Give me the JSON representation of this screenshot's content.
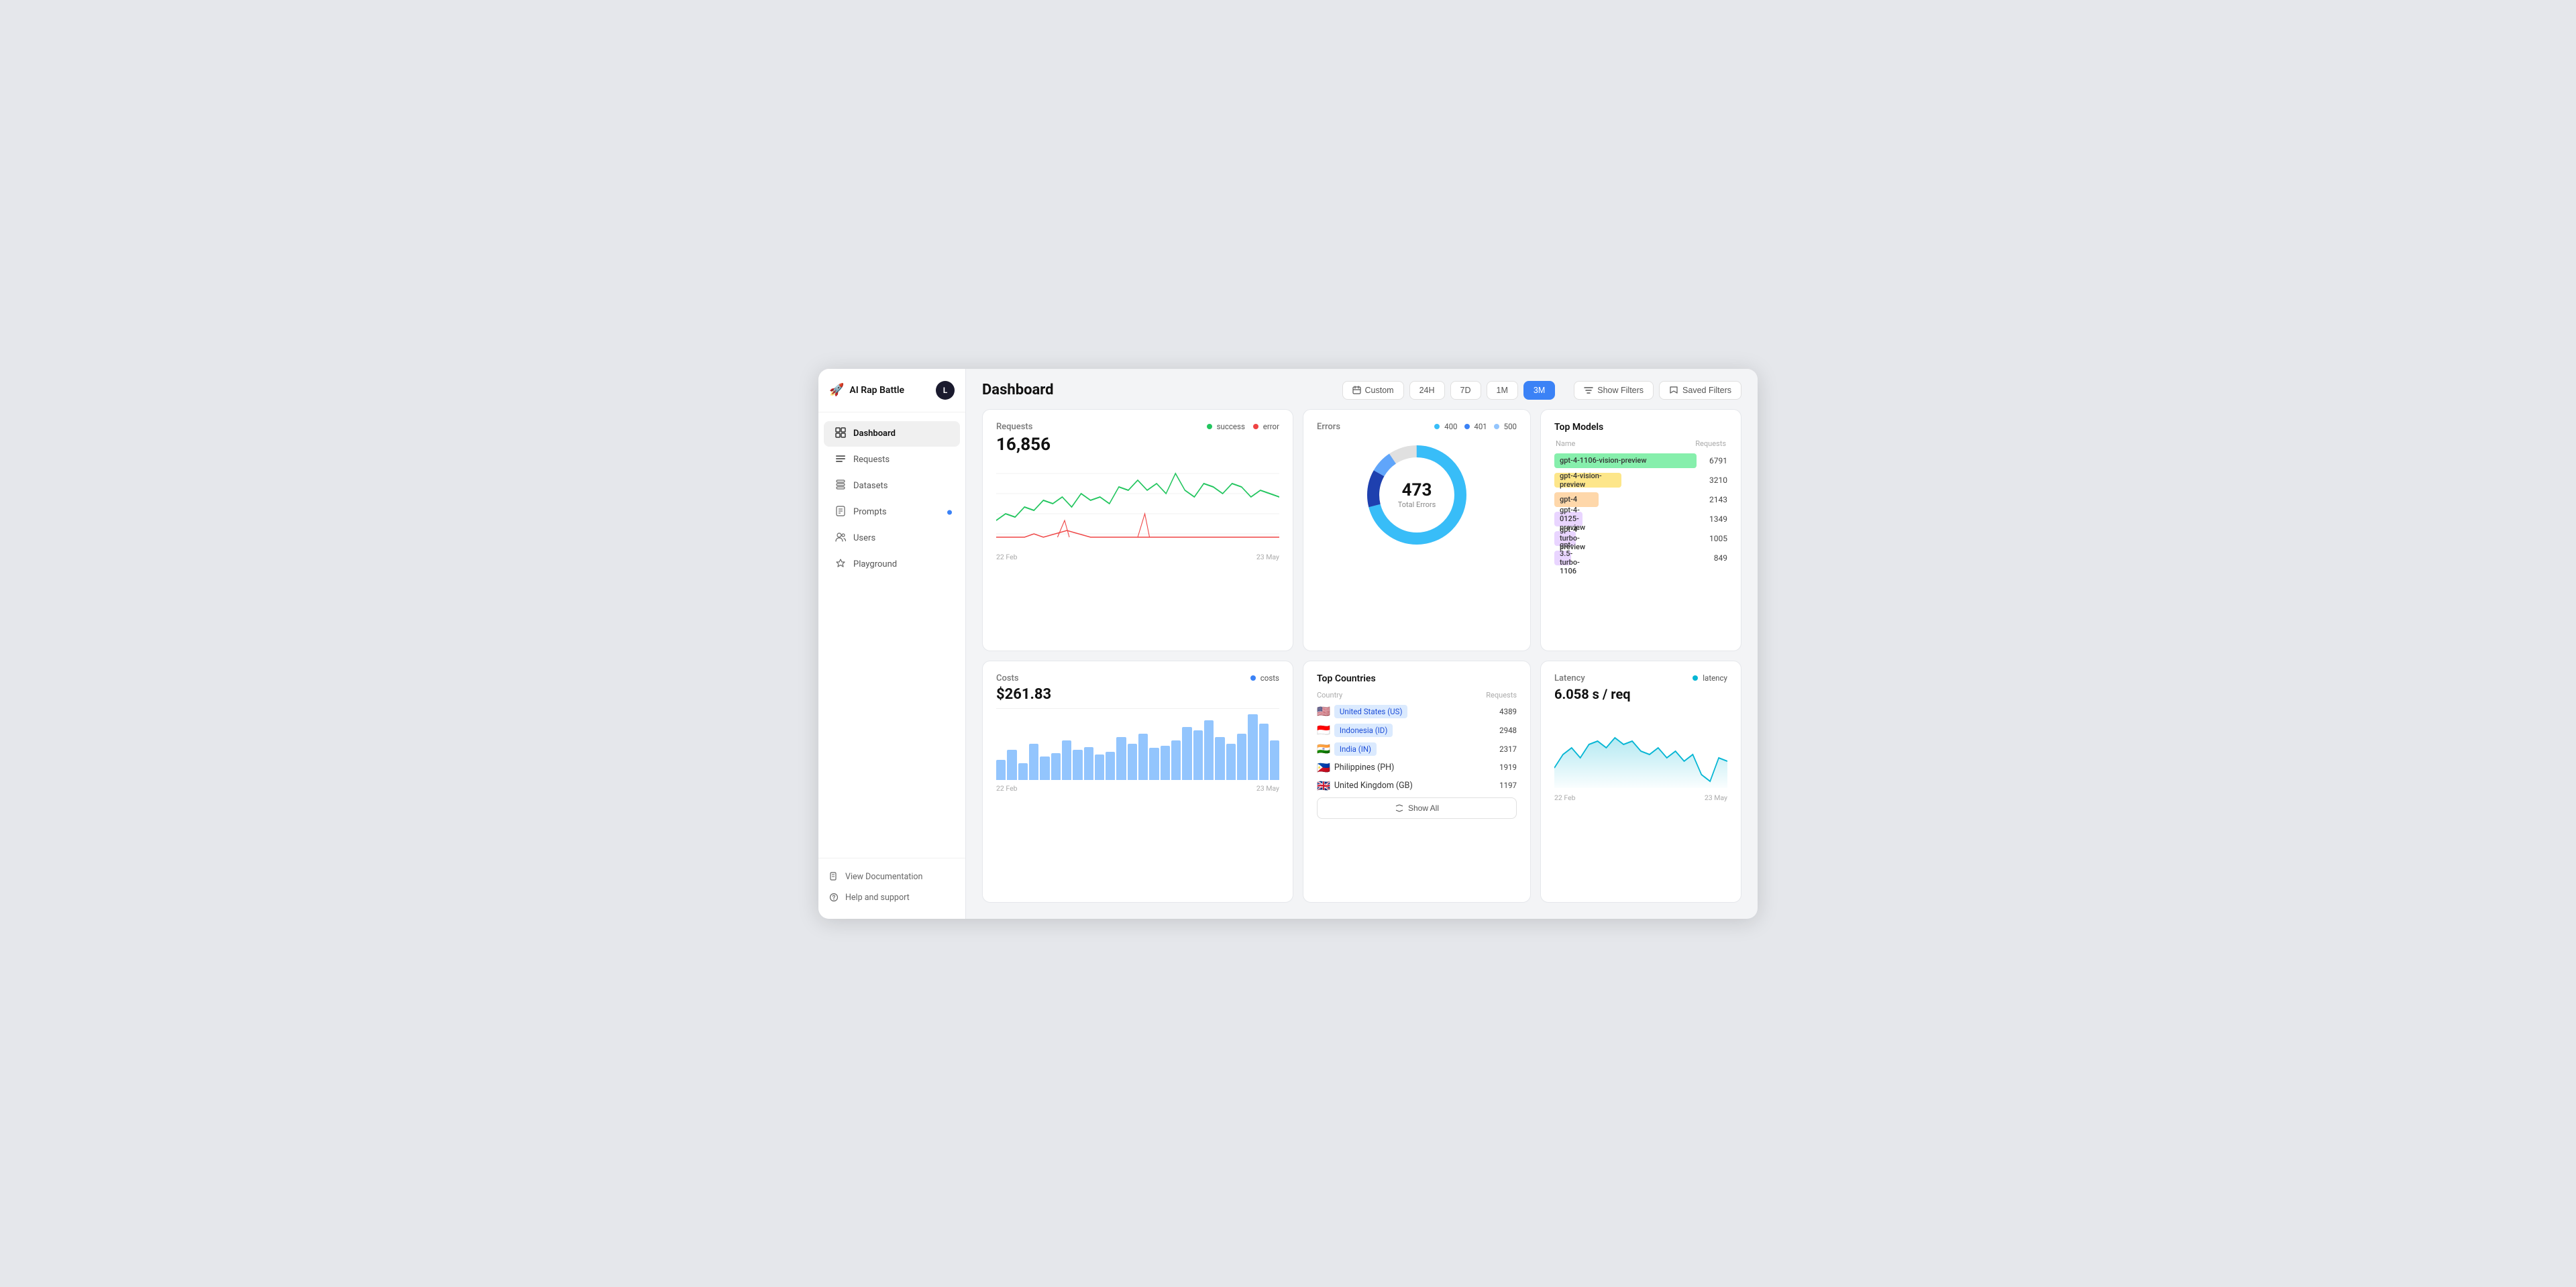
{
  "app": {
    "name": "AI Rap Battle",
    "avatar_letter": "L"
  },
  "sidebar": {
    "nav_items": [
      {
        "id": "dashboard",
        "label": "Dashboard",
        "icon": "⊞",
        "active": true
      },
      {
        "id": "requests",
        "label": "Requests",
        "icon": "☰",
        "active": false
      },
      {
        "id": "datasets",
        "label": "Datasets",
        "icon": "🗂",
        "active": false
      },
      {
        "id": "prompts",
        "label": "Prompts",
        "icon": "📄",
        "active": false,
        "dot": true
      },
      {
        "id": "users",
        "label": "Users",
        "icon": "👥",
        "active": false
      },
      {
        "id": "playground",
        "label": "Playground",
        "icon": "🔬",
        "active": false
      }
    ],
    "footer_items": [
      {
        "id": "docs",
        "label": "View Documentation",
        "icon": "📖"
      },
      {
        "id": "support",
        "label": "Help and support",
        "icon": "❓"
      }
    ]
  },
  "header": {
    "title": "Dashboard",
    "time_buttons": [
      {
        "label": "Custom",
        "id": "custom",
        "active": false,
        "icon": "📅"
      },
      {
        "label": "24H",
        "id": "24h",
        "active": false
      },
      {
        "label": "7D",
        "id": "7d",
        "active": false
      },
      {
        "label": "1M",
        "id": "1m",
        "active": false
      },
      {
        "label": "3M",
        "id": "3m",
        "active": true
      }
    ],
    "action_buttons": [
      {
        "label": "Show Filters",
        "id": "show-filters",
        "icon": "filter"
      },
      {
        "label": "Saved Filters",
        "id": "saved-filters",
        "icon": "bookmark"
      }
    ]
  },
  "cards": {
    "requests": {
      "title": "Requests",
      "value": "16,856",
      "legend": [
        {
          "label": "success",
          "color": "#22c55e"
        },
        {
          "label": "error",
          "color": "#ef4444"
        }
      ],
      "date_start": "22 Feb",
      "date_end": "23 May"
    },
    "errors": {
      "title": "Errors",
      "legend": [
        {
          "label": "400",
          "color": "#38bdf8"
        },
        {
          "label": "401",
          "color": "#3b82f6"
        },
        {
          "label": "500",
          "color": "#93c5fd"
        }
      ],
      "total": "473",
      "total_label": "Total Errors"
    },
    "top_models": {
      "title": "Top Models",
      "col_name": "Name",
      "col_requests": "Requests",
      "models": [
        {
          "name": "gpt-4-1106-vision-preview",
          "count": 6791,
          "color": "#86efac",
          "width": 100
        },
        {
          "name": "gpt-4-vision-preview",
          "count": 3210,
          "color": "#fde68a",
          "width": 47
        },
        {
          "name": "gpt-4",
          "count": 2143,
          "color": "#fed7aa",
          "width": 31
        },
        {
          "name": "gpt-4-0125-preview",
          "count": 1349,
          "color": "#e9d5ff",
          "width": 20
        },
        {
          "name": "gpt-4-turbo-preview",
          "count": 1005,
          "color": "#e9d5ff",
          "width": 15
        },
        {
          "name": "gpt-3.5-turbo-1106",
          "count": 849,
          "color": "#e9d5ff",
          "width": 12
        }
      ]
    },
    "costs": {
      "title": "Costs",
      "value": "$261.83",
      "legend_label": "costs",
      "legend_color": "#3b82f6",
      "date_start": "22 Feb",
      "date_end": "23 May"
    },
    "top_countries": {
      "title": "Top Countries",
      "col_country": "Country",
      "col_requests": "Requests",
      "countries": [
        {
          "flag": "🇺🇸",
          "name": "United States (US)",
          "count": 4389
        },
        {
          "flag": "🇮🇩",
          "name": "Indonesia (ID)",
          "count": 2948
        },
        {
          "flag": "🇮🇳",
          "name": "India (IN)",
          "count": 2317
        },
        {
          "flag": "🇵🇭",
          "name": "Philippines (PH)",
          "count": 1919
        },
        {
          "flag": "🇬🇧",
          "name": "United Kingdom (GB)",
          "count": 1197
        }
      ],
      "show_all_label": "Show All"
    },
    "latency": {
      "title": "Latency",
      "value": "6.058 s / req",
      "legend_label": "latency",
      "legend_color": "#06b6d4",
      "date_start": "22 Feb",
      "date_end": "23 May"
    }
  }
}
